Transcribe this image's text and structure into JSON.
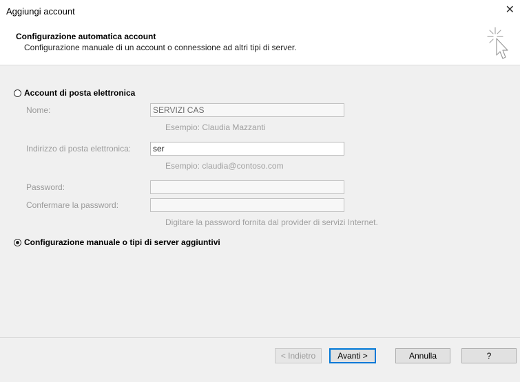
{
  "window": {
    "title": "Aggiungi account",
    "close_glyph": "✕"
  },
  "header": {
    "title": "Configurazione automatica account",
    "subtitle": "Configurazione manuale di un account o connessione ad altri tipi di server.",
    "icon": "cursor-sparkle-icon"
  },
  "options": {
    "email_account": {
      "label": "Account di posta elettronica",
      "selected": false
    },
    "manual_setup": {
      "label": "Configurazione manuale o tipi di server aggiuntivi",
      "selected": true
    }
  },
  "form": {
    "name": {
      "label": "Nome:",
      "value": "SERVIZI CAS",
      "hint": "Esempio: Claudia Mazzanti"
    },
    "email": {
      "label": "Indirizzo di posta elettronica:",
      "value": "ser",
      "hint": "Esempio: claudia@contoso.com"
    },
    "password": {
      "label": "Password:",
      "value": ""
    },
    "confirm_password": {
      "label": "Confermare la password:",
      "value": "",
      "hint": "Digitare la password fornita dal provider di servizi Internet."
    }
  },
  "buttons": {
    "back": "< Indietro",
    "next": "Avanti >",
    "cancel": "Annulla",
    "help": "?"
  },
  "colors": {
    "accent": "#0078d7",
    "disabled_text": "#9a9a9a",
    "background": "#f0f0f0"
  }
}
